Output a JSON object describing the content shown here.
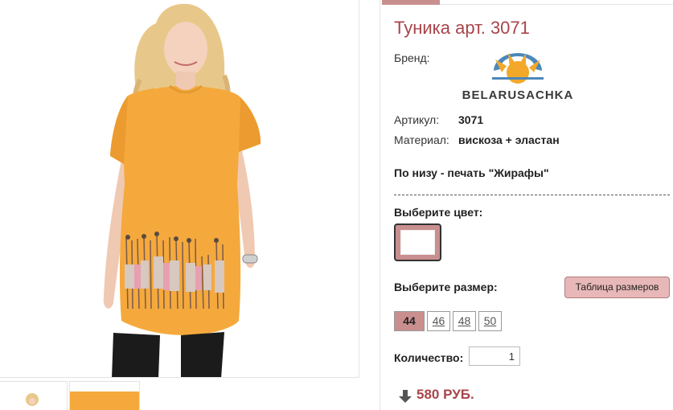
{
  "product": {
    "title": "Туника арт. 3071",
    "brand_label": "Бренд:",
    "brand_name": "BELARUSACHKA",
    "article_label": "Артикул:",
    "article_value": "3071",
    "material_label": "Материал:",
    "material_value": "вискоза + эластан",
    "note": "По низу - печать \"Жирафы\""
  },
  "color": {
    "label": "Выберите цвет:",
    "selected": "#ffffff",
    "frame_color": "#c98f8f"
  },
  "size": {
    "label": "Выберите размер:",
    "table_button": "Таблица размеров",
    "options": [
      "44",
      "46",
      "48",
      "50"
    ],
    "selected": "44"
  },
  "quantity": {
    "label": "Количество:",
    "value": "1"
  },
  "price": {
    "value": "580 РУБ.",
    "icon": "down-arrow-icon"
  },
  "images": {
    "main": "product-photo",
    "thumbnails": [
      "thumbnail-1",
      "thumbnail-2"
    ]
  },
  "colors": {
    "accent": "#a8454a",
    "button": "#e8b7b7",
    "tunic": "#f5a93d"
  }
}
